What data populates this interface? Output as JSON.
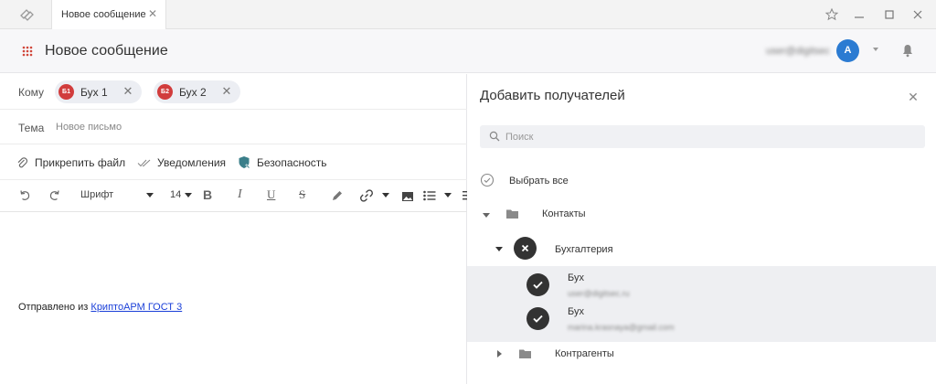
{
  "window": {
    "tab_label": "Новое сообщение",
    "tab_close": "✕"
  },
  "header": {
    "title": "Новое сообщение",
    "user_email": "user@digitsec",
    "avatar_letter": "A"
  },
  "compose": {
    "to_label": "Кому",
    "recipients": [
      {
        "badge": "Б1",
        "name": "Бух 1"
      },
      {
        "badge": "Б2",
        "name": "Бух 2"
      }
    ],
    "subject_label": "Тема",
    "subject_placeholder": "Новое письмо",
    "attach_label": "Прикрепить файл",
    "notifications_label": "Уведомления",
    "security_label": "Безопасность",
    "toolbar": {
      "font_label": "Шрифт",
      "size_value": "14",
      "bold": "B",
      "italic": "I",
      "underline": "U",
      "strike": "S"
    },
    "signature_prefix": "Отправлено из ",
    "signature_link": "КриптоАРМ ГОСТ 3"
  },
  "panel": {
    "title": "Добавить получателей",
    "search_placeholder": "Поиск",
    "select_all": "Выбрать все",
    "contacts": "Контакты",
    "group": "Бухгалтерия",
    "members": [
      {
        "name": "Бух",
        "email": "user@digitsec.ru"
      },
      {
        "name": "Бух",
        "email": "marina.krasnaya@gmail.com"
      }
    ],
    "partners": "Контрагенты"
  },
  "colors": {
    "avatar": "#2b7bd2",
    "badge": "#d13c3c",
    "link": "#1a3fd8",
    "check": "#333333"
  }
}
